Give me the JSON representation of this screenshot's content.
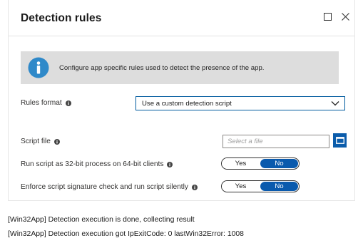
{
  "panel": {
    "title": "Detection rules"
  },
  "banner": {
    "text": "Configure app specific rules used to detect the presence of the app."
  },
  "form": {
    "rules_format": {
      "label": "Rules format",
      "value": "Use a custom detection script"
    },
    "script_file": {
      "label": "Script file",
      "placeholder": "Select a file"
    },
    "run_32bit": {
      "label": "Run script as 32-bit process on 64-bit clients",
      "yes": "Yes",
      "no": "No",
      "selected": "No"
    },
    "enforce_signature": {
      "label": "Enforce script signature check and run script silently",
      "yes": "Yes",
      "no": "No",
      "selected": "No"
    }
  },
  "log": {
    "line1": "[Win32App] Detection execution is done, collecting result",
    "line2": "[Win32App] Detection execution got IpExitCode: 0 lastWin32Error: 1008"
  },
  "colors": {
    "accent": "#0a5aad",
    "info_icon": "#2f89c9",
    "banner_bg": "#dddddd"
  },
  "icons": {
    "maximize": "maximize-icon",
    "close": "close-icon",
    "info": "info-icon",
    "chevron": "chevron-down-icon",
    "browse": "folder-browse-icon"
  }
}
